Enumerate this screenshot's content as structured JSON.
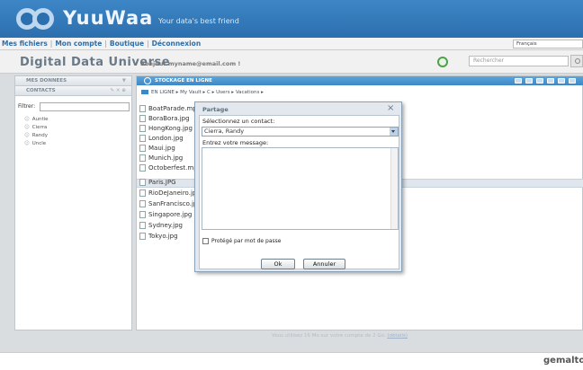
{
  "header": {
    "brand": "YuuWaa",
    "tagline": "Your data's best friend"
  },
  "nav": {
    "items": [
      "Mes fichiers",
      "Mon compte",
      "Boutique",
      "Déconnexion"
    ],
    "language": "Français"
  },
  "subheader": {
    "title": "Digital Data Universe",
    "greeting": "Bonjour myname@email.com !",
    "search_placeholder": "Rechercher"
  },
  "left_panel": {
    "section1": "MES DONNEES",
    "section2": "CONTACTS",
    "filter_label": "Filtrer:",
    "contacts": [
      "Auntie",
      "Cierra",
      "Randy",
      "Uncle"
    ]
  },
  "main_panel": {
    "title": "STOCKAGE EN LIGNE",
    "breadcrumb": [
      "EN LIGNE",
      "My Vault",
      "C",
      "Users",
      "Vacations"
    ],
    "files": [
      "BoatParade.mp4",
      "BoraBora.jpg",
      "HongKong.jpg",
      "London.jpg",
      "Maui.jpg",
      "Munich.jpg",
      "Octoberfest.mp4",
      "Paris.JPG",
      "RioDeJaneiro.jpg",
      "SanFrancisco.jpg",
      "Singapore.jpg",
      "Sydney.jpg",
      "Tokyo.jpg"
    ],
    "selected_file": "Paris.JPG",
    "footer_note": "Vous utilisez 16 Mo sur votre compte de 2 Go.",
    "footer_link": "(détails)"
  },
  "dialog": {
    "title": "Partage",
    "close": "×",
    "contact_label": "Sélectionnez un contact:",
    "contact_value": "Cierra, Randy",
    "message_label": "Entrez votre message:",
    "password_label": "Protégé par mot de passe",
    "ok_label": "Ok",
    "cancel_label": "Annuler"
  },
  "footer": {
    "logo": "gemalto"
  }
}
